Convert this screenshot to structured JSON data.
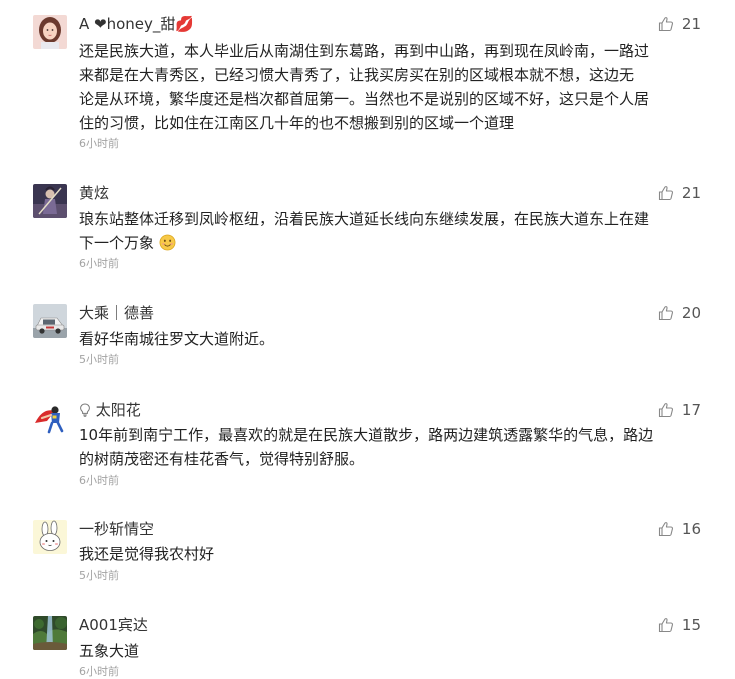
{
  "comments": [
    {
      "user": "A ❤honey_甜💋",
      "likes": "21",
      "lines": [
        "还是民族大道，本人毕业后从南湖住到东葛路，再到中山路，再到现在凤岭南，一路过",
        "来都是在大青秀区，已经习惯大青秀了，让我买房买在别的区域根本就不想，这边无",
        "论是从环境，繁华度还是档次都首屈第一。当然也不是说别的区域不好，这只是个人居",
        "住的习惯，比如住在江南区几十年的也不想搬到别的区域一个道理"
      ],
      "time": "6小时前"
    },
    {
      "user": "黄炫",
      "likes": "21",
      "lines": [
        "琅东站整体迁移到凤岭枢纽，沿着民族大道延长线向东继续发展，在民族大道东上在建",
        "下一个万象"
      ],
      "time": "6小时前"
    },
    {
      "user": "大乘｜德善",
      "likes": "20",
      "lines": [
        "看好华南城往罗文大道附近。"
      ],
      "time": "5小时前"
    },
    {
      "user": "太阳花",
      "likes": "17",
      "lines": [
        "10年前到南宁工作，最喜欢的就是在民族大道散步，路两边建筑透露繁华的气息，路边",
        "的树荫茂密还有桂花香气，觉得特别舒服。"
      ],
      "time": "6小时前"
    },
    {
      "user": "一秒斩情空",
      "likes": "16",
      "lines": [
        "我还是觉得我农村好"
      ],
      "time": "5小时前"
    },
    {
      "user": "A001宾达",
      "likes": "15",
      "lines": [
        "五象大道"
      ],
      "time": "6小时前"
    }
  ],
  "icons": {
    "like": "thumbs-up-icon",
    "smile": "smiley-emoji-icon",
    "bulb": "lightbulb-icon"
  },
  "colors": {
    "text": "#222222",
    "time": "#a3a3a3",
    "like": "#666666"
  }
}
